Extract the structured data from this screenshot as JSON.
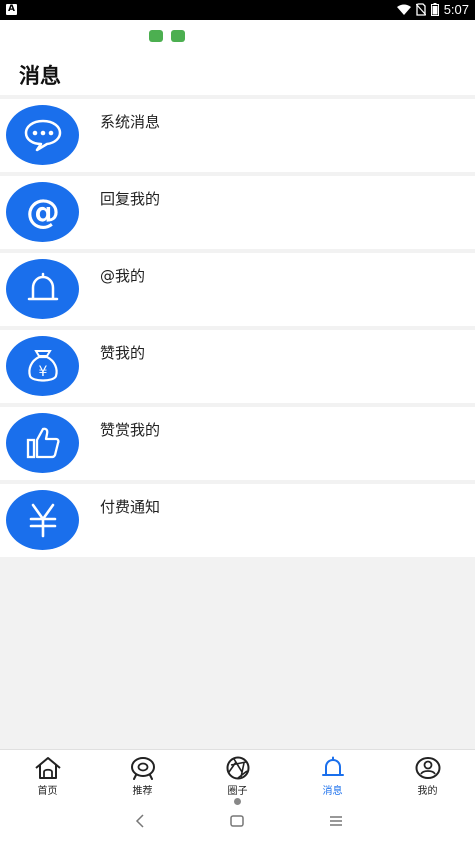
{
  "status_bar": {
    "app_badge": "A",
    "time": "5:07"
  },
  "header": {
    "title": "消息"
  },
  "messages": [
    {
      "label": "系统消息",
      "icon": "chat-bubble-icon"
    },
    {
      "label": "回复我的",
      "icon": "at-sign-icon"
    },
    {
      "label": "@我的",
      "icon": "bell-icon"
    },
    {
      "label": "赞我的",
      "icon": "money-bag-icon"
    },
    {
      "label": "赞赏我的",
      "icon": "thumbs-up-icon"
    },
    {
      "label": "付费通知",
      "icon": "yen-icon"
    }
  ],
  "bottom_nav": [
    {
      "label": "首页",
      "icon": "home-icon"
    },
    {
      "label": "推荐",
      "icon": "recommend-icon"
    },
    {
      "label": "圈子",
      "icon": "aperture-icon"
    },
    {
      "label": "消息",
      "icon": "bell-icon",
      "active": true
    },
    {
      "label": "我的",
      "icon": "user-icon"
    }
  ],
  "colors": {
    "accent": "#1a6fec",
    "background": "#f2f2f2"
  }
}
